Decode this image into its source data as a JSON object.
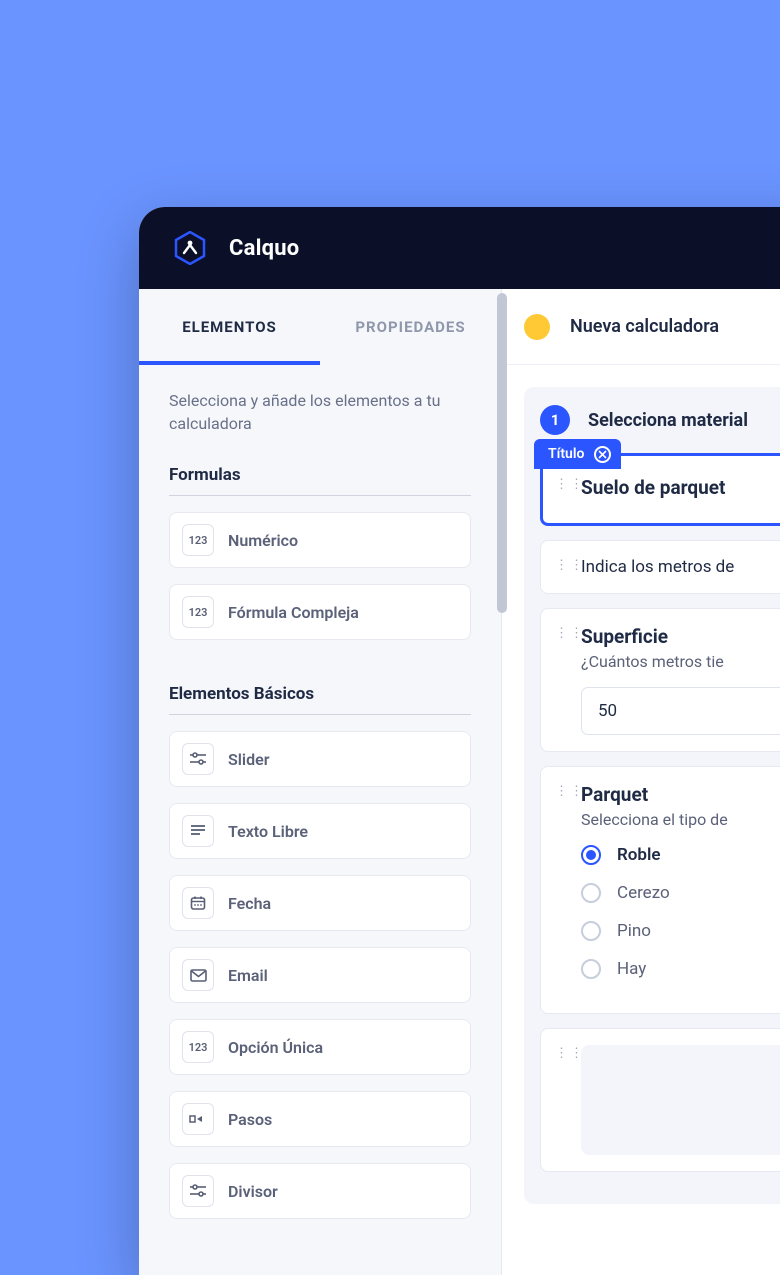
{
  "app": {
    "title": "Calquo"
  },
  "sidebar": {
    "tabs": {
      "elements": "ELEMENTOS",
      "properties": "PROPIEDADES"
    },
    "helper": "Selecciona y añade los elementos a tu calculadora",
    "sections": {
      "formulas": {
        "title": "Formulas",
        "items": [
          {
            "icon": "123",
            "label": "Numérico"
          },
          {
            "icon": "123",
            "label": "Fórmula Compleja"
          }
        ]
      },
      "basics": {
        "title": "Elementos Básicos",
        "items": [
          {
            "icon": "sliders",
            "label": "Slider"
          },
          {
            "icon": "text",
            "label": "Texto Libre"
          },
          {
            "icon": "date",
            "label": "Fecha"
          },
          {
            "icon": "mail",
            "label": "Email"
          },
          {
            "icon": "123",
            "label": "Opción Única"
          },
          {
            "icon": "steps",
            "label": "Pasos"
          },
          {
            "icon": "sliders",
            "label": "Divisor"
          }
        ]
      }
    }
  },
  "canvas": {
    "header": {
      "title": "Nueva calculadora",
      "status_color": "#ffc935"
    },
    "step": {
      "num": "1",
      "label": "Selecciona material",
      "chip": "Título",
      "cards": {
        "title": {
          "value": "Suelo de parquet"
        },
        "subtitle": {
          "value": "Indica los metros de"
        },
        "surface": {
          "title": "Superficie",
          "sub": "¿Cuántos metros tie",
          "input": "50"
        },
        "parquet": {
          "title": "Parquet",
          "sub": "Selecciona el tipo de",
          "options": [
            "Roble",
            "Cerezo",
            "Pino",
            "Hay"
          ],
          "selected": 0
        }
      }
    }
  }
}
